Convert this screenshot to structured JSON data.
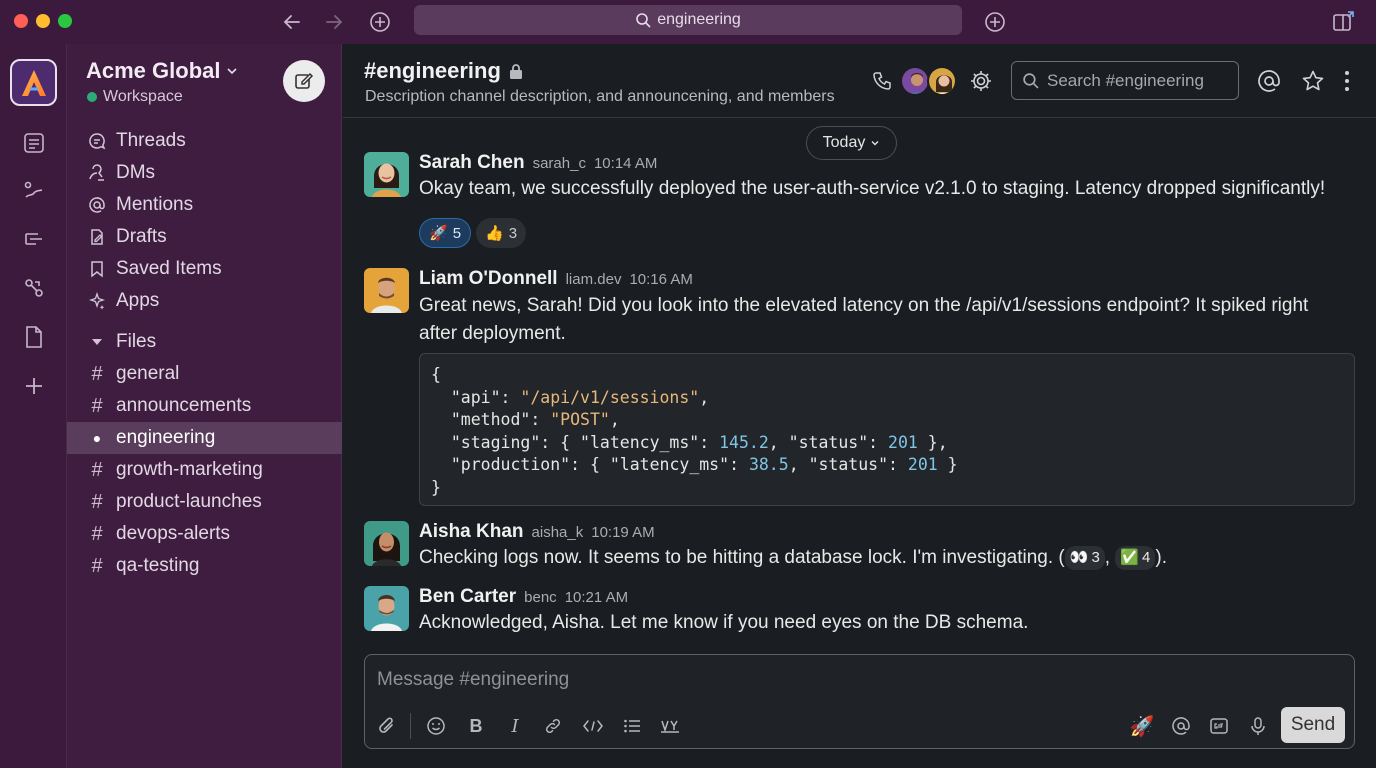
{
  "titlebar": {
    "search_text": "engineering",
    "traffic_colors": [
      "#ff5f57",
      "#febc2e",
      "#28c840"
    ]
  },
  "workspace": {
    "name": "Acme Global",
    "status": "Workspace",
    "logo_letter": "A"
  },
  "sidebar": {
    "nav": [
      {
        "label": "Threads",
        "icon": "threads-icon"
      },
      {
        "label": "DMs",
        "icon": "dms-icon"
      },
      {
        "label": "Mentions",
        "icon": "at-icon"
      },
      {
        "label": "Drafts",
        "icon": "drafts-icon"
      },
      {
        "label": "Saved Items",
        "icon": "bookmark-icon"
      },
      {
        "label": "Apps",
        "icon": "apps-icon"
      }
    ],
    "files_label": "Files",
    "channels": [
      {
        "name": "general",
        "active": false
      },
      {
        "name": "announcements",
        "active": false
      },
      {
        "name": "engineering",
        "active": true
      },
      {
        "name": "growth-marketing",
        "active": false
      },
      {
        "name": "product-launches",
        "active": false
      },
      {
        "name": "devops-alerts",
        "active": false
      },
      {
        "name": "qa-testing",
        "active": false
      }
    ]
  },
  "channel": {
    "title": "#engineering",
    "description": "Description channel description, and announcening, and members",
    "search_placeholder": "Search #engineering"
  },
  "divider": {
    "label": "Today"
  },
  "messages": [
    {
      "author": "Sarah Chen",
      "handle": "sarah_c",
      "time": "10:14 AM",
      "text": "Okay team, we successfully deployed the user-auth-service v2.1.0 to staging. Latency dropped significantly!",
      "reactions": [
        {
          "emoji": "🚀",
          "count": "5"
        },
        {
          "emoji": "👍",
          "count": "3"
        }
      ]
    },
    {
      "author": "Liam O'Donnell",
      "handle": "liam.dev",
      "time": "10:16 AM",
      "text_line1": "Great news, Sarah! Did you look into the elevated latency on the /api/v1/sessions endpoint? It spiked right",
      "text_line2": "after deployment."
    },
    {
      "author": "Aisha Khan",
      "handle": "aisha_k",
      "time": "10:19 AM",
      "text": "Checking logs now. It seems to be hitting a database lock. I'm investigating. (",
      "inline_reactions": [
        {
          "emoji": "👀",
          "count": "3"
        },
        {
          "emoji": "✅",
          "count": "4"
        }
      ],
      "text_end": ")."
    },
    {
      "author": "Ben Carter",
      "handle": "benc",
      "time": "10:21 AM",
      "text": "Acknowledged, Aisha. Let me know if you need eyes on the DB schema."
    }
  ],
  "code": {
    "open": "{",
    "api_key": "\"api\"",
    "api_val": "\"/api/v1/sessions\"",
    "method_key": "\"method\"",
    "method_val": "\"POST\"",
    "staging_key": "\"staging\"",
    "latency_key": "\"latency_ms\"",
    "status_key": "\"status\"",
    "staging_latency": "145.2",
    "staging_status": "201",
    "production_key": "\"production\"",
    "production_latency": "38.5",
    "production_status": "201",
    "close": "}"
  },
  "composer": {
    "placeholder": "Message #engineering",
    "send_label": "Send"
  }
}
